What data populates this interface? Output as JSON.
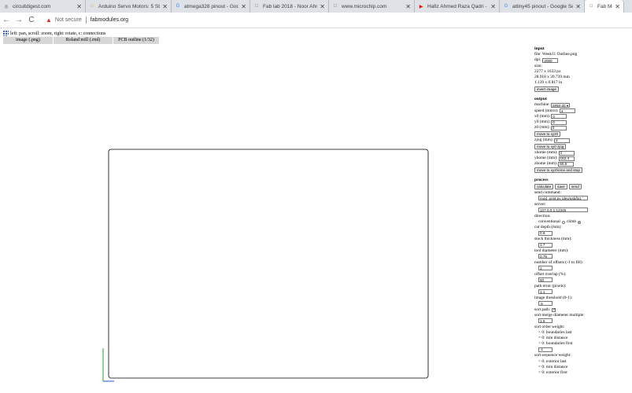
{
  "browser": {
    "tabs": [
      {
        "title": "circuitdigest.com",
        "icon": "globe-icon",
        "icon_glyph": "◎",
        "icon_color": "#5f6368",
        "active": false
      },
      {
        "title": "Arduino Servo Motors: 5 Ste",
        "icon": "instructables-icon",
        "icon_glyph": "☺",
        "icon_color": "#f5a623",
        "active": false
      },
      {
        "title": "atmega328 pinout - Google",
        "icon": "google-icon",
        "icon_glyph": "G",
        "icon_color": "#4285f4",
        "active": false
      },
      {
        "title": "Fab lab 2018 - Noor Ahmed",
        "icon": "page-icon",
        "icon_glyph": "□",
        "icon_color": "#5f6368",
        "active": false
      },
      {
        "title": "www.microchip.com",
        "icon": "page-icon",
        "icon_glyph": "□",
        "icon_color": "#5f6368",
        "active": false
      },
      {
        "title": "Hafiz Ahmed Raza Qadri - N",
        "icon": "youtube-icon",
        "icon_glyph": "▶",
        "icon_color": "#ff0000",
        "active": false
      },
      {
        "title": "attiny45 pinout - Google Se",
        "icon": "google-icon",
        "icon_glyph": "G",
        "icon_color": "#4285f4",
        "active": false
      },
      {
        "title": "Fab Modules",
        "icon": "page-icon",
        "icon_glyph": "□",
        "icon_color": "#5f6368",
        "active": true
      }
    ],
    "close_glyph": "✕",
    "nav": {
      "back": "←",
      "forward": "→",
      "reload": "C"
    },
    "security_label": "Not secure",
    "url": "fabmodules.org"
  },
  "app": {
    "hint": "left: pan, scroll: zoom, right: rotate, c: connections",
    "module_tabs": [
      "image (.png)",
      "Roland mill (.rml)",
      "PCB outline (1/32)"
    ]
  },
  "panel": {
    "input": {
      "heading": "input",
      "file": "file: Week11 Outline.png",
      "dpi_label": "dpi:",
      "dpi": "2000",
      "size_label": "size:",
      "size_px": "2277 x 1633 px",
      "size_mm": "28.918 x 20.739 mm",
      "size_in": "1.139 x 0.817 in",
      "invert_button": "invert image"
    },
    "output": {
      "heading": "output",
      "machine_label": "machine:",
      "machine": "SRM-20 ▾",
      "speed_label": "speed (mm/s):",
      "speed": "4",
      "x0_label": "x0 (mm):",
      "x0": "0",
      "y0_label": "y0 (mm):",
      "y0": "0",
      "z0_label": "z0 (mm):",
      "z0": "0",
      "move_xyz0": "move to xyz0",
      "zjog_label": "zjog (mm):",
      "zjog": "2",
      "move_xy0_zjog": "move to xy0 zjog",
      "xhome_label": "xhome (mm):",
      "xhome": "0",
      "yhome_label": "yhome (mm):",
      "yhome": "152.4",
      "zhome_label": "zhome (mm):",
      "zhome": "60.5",
      "move_home": "move to xyzhome and stop"
    },
    "process": {
      "heading": "process",
      "calculate": "calculate",
      "save": "save",
      "send": "send",
      "send_command_label": "send command:",
      "send_command": "mod_print.py /dev/usb/lp1 ‘",
      "server_label": "server:",
      "server": "127.0.0.1:12345",
      "direction_label": "direction:",
      "conventional": "conventional",
      "climb": "climb",
      "cut_depth_label": "cut depth (mm):",
      "cut_depth": "0.6",
      "stock_label": "stock thickness (mm):",
      "stock": "1.7",
      "tool_label": "tool diameter (mm):",
      "tool": "0.79",
      "offsets_label": "number of offsets (-1 to fill):",
      "offsets": "1",
      "overlap_label": "offset overlap (%):",
      "overlap": "50",
      "path_error_label": "path error (pixels):",
      "path_error": "1.1",
      "threshold_label": "image threshold (0-1):",
      "threshold": ".5",
      "sort_path_label": "sort path:",
      "sort_merge_label": "sort merge diameter multiple:",
      "sort_merge": "1.5",
      "sort_order_label": "sort order weight:",
      "sort_order_items": [
        "< 0: boundaries last",
        "= 0: min distance",
        "> 0: boundaries first"
      ],
      "sort_order_value": "-1",
      "sort_seq_label": "sort sequence weight:",
      "sort_seq_items": [
        "< 0: exterior last",
        "= 0: min distance",
        "> 0: exterior first"
      ]
    }
  },
  "colors": {
    "axis_y": "#22aa22",
    "axis_x": "#2255cc",
    "outline": "#000000",
    "warning": "#d93025"
  }
}
